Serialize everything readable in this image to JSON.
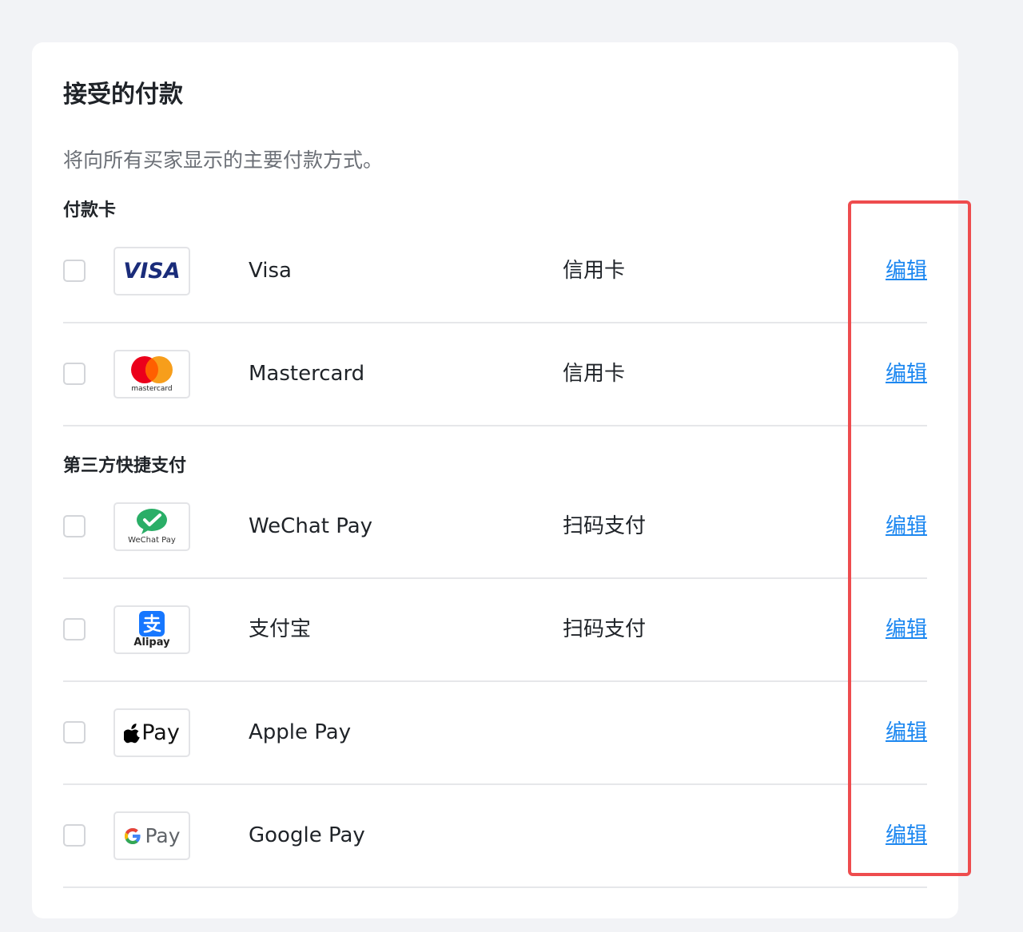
{
  "card": {
    "title": "接受的付款",
    "description": "将向所有买家显示的主要付款方式。"
  },
  "sections": {
    "cards_title": "付款卡",
    "third_party_title": "第三方快捷支付"
  },
  "methods": [
    {
      "name": "Visa",
      "type": "信用卡",
      "edit": "编辑",
      "logo_text": "VISA",
      "logo": "visa-logo-icon"
    },
    {
      "name": "Mastercard",
      "type": "信用卡",
      "edit": "编辑",
      "logo_text": "mastercard",
      "logo": "mastercard-logo-icon"
    },
    {
      "name": "WeChat Pay",
      "type": "扫码支付",
      "edit": "编辑",
      "logo_text": "WeChat Pay",
      "logo": "wechat-pay-logo-icon"
    },
    {
      "name": "支付宝",
      "type": "扫码支付",
      "edit": "编辑",
      "logo_text": "Alipay",
      "logo": "alipay-logo-icon"
    },
    {
      "name": "Apple Pay",
      "type": "",
      "edit": "编辑",
      "logo_text": "Pay",
      "logo": "apple-pay-logo-icon"
    },
    {
      "name": "Google Pay",
      "type": "",
      "edit": "编辑",
      "logo_text": "Pay",
      "logo": "google-pay-logo-icon"
    }
  ],
  "colors": {
    "link": "#1a86f0",
    "highlight": "#ee4c4e",
    "background": "#f2f3f6",
    "visa_blue": "#1a2c7a",
    "mc_red": "#eb001b",
    "mc_orange": "#f79e1b",
    "wechat_green": "#2aae67",
    "alipay_blue": "#1677ff"
  }
}
